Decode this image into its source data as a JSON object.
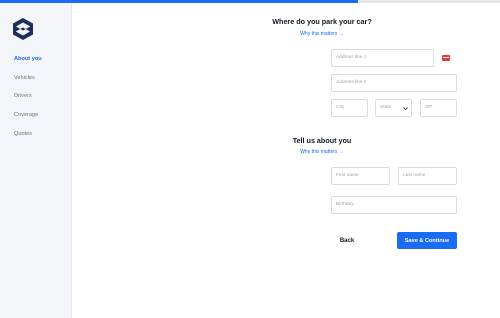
{
  "progress": {
    "fraction": 0.715,
    "color": "#1a6cf5"
  },
  "logo": {
    "name": "shield-logo",
    "color": "#1f2d5c"
  },
  "sidebar": {
    "items": [
      {
        "label": "About you",
        "active": true
      },
      {
        "label": "Vehicles",
        "active": false
      },
      {
        "label": "Drivers",
        "active": false
      },
      {
        "label": "Coverage",
        "active": false
      },
      {
        "label": "Quotes",
        "active": false
      }
    ]
  },
  "parking": {
    "title": "Where do you park your car?",
    "why_label": "Why this matters →",
    "address1_placeholder": "Address line 1",
    "address1_icon": "address-autofill-icon",
    "address2_placeholder": "Address line 2",
    "city_placeholder": "City",
    "state_selected": "State",
    "zip_placeholder": "ZIP"
  },
  "about": {
    "title": "Tell us about you",
    "why_label": "Why this matters →",
    "first_name_placeholder": "First name",
    "last_name_placeholder": "Last name",
    "birthday_placeholder": "Birthday"
  },
  "actions": {
    "back_label": "Back",
    "save_label": "Save & Continue"
  }
}
